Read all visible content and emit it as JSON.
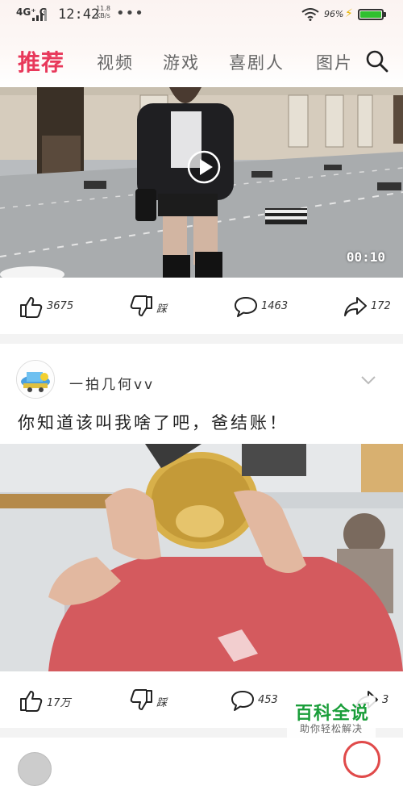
{
  "status_bar": {
    "network": "4G⁺ G",
    "time": "12:42",
    "speed": "11.8 KB/s",
    "battery_percent": "96%",
    "colors": {
      "battery": "#2fc02f",
      "charge": "#e8b400"
    }
  },
  "header": {
    "tabs": [
      {
        "label": "推荐",
        "active": true
      },
      {
        "label": "视频",
        "active": false
      },
      {
        "label": "游戏",
        "active": false
      },
      {
        "label": "喜剧人",
        "active": false
      },
      {
        "label": "图片",
        "active": false
      }
    ],
    "accent_color": "#e8385a",
    "search_icon": "search-icon"
  },
  "feed": [
    {
      "video": {
        "duration": "00:10",
        "has_play_button": true
      },
      "actions": {
        "like": "3675",
        "dislike": "踩",
        "comment": "1463",
        "share": "172"
      }
    },
    {
      "author": "一拍几何vv",
      "text": "你知道该叫我啥了吧，爸结账！",
      "actions": {
        "like": "17万",
        "dislike": "踩",
        "comment": "453",
        "share": "3"
      }
    }
  ],
  "watermark": {
    "title": "百科全说",
    "subtitle": "助你轻松解决",
    "color": "#1a9e3a"
  }
}
